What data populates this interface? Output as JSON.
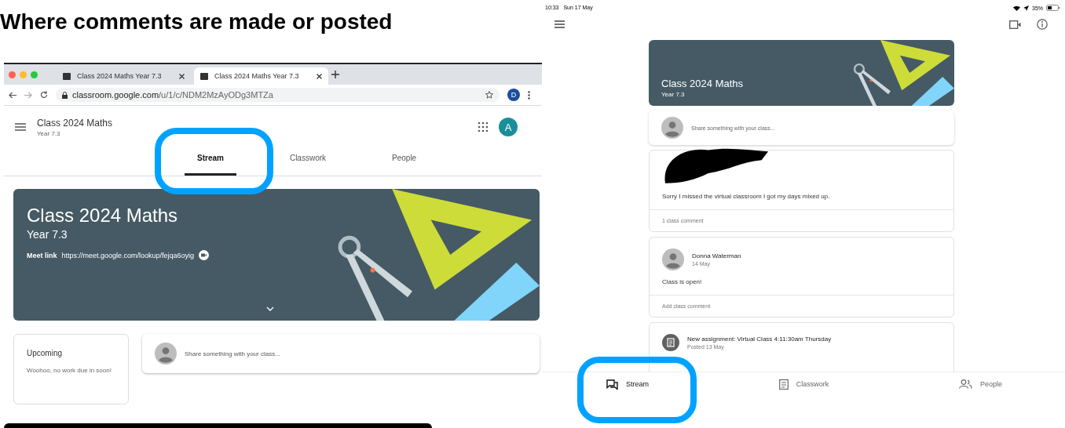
{
  "slide_title": "Where comments are made or posted",
  "browser": {
    "tabs": [
      {
        "label": "Class 2024 Maths Year 7.3",
        "selected": false
      },
      {
        "label": "Class 2024 Maths Year 7.3",
        "selected": true
      }
    ],
    "url_host": "classroom.google.com",
    "url_path": "/u/1/c/NDM2MzAyODg3MTZa",
    "profile_initial": "D"
  },
  "web_app": {
    "class_name": "Class 2024 Maths",
    "section": "Year 7.3",
    "account_initial": "A",
    "nav_tabs": [
      {
        "label": "Stream",
        "selected": true
      },
      {
        "label": "Classwork",
        "selected": false
      },
      {
        "label": "People",
        "selected": false
      }
    ],
    "banner": {
      "title": "Class 2024 Maths",
      "subtitle": "Year 7.3",
      "meet_label": "Meet link",
      "meet_url": "https://meet.google.com/lookup/fejqa6oyig"
    },
    "upcoming": {
      "title": "Upcoming",
      "text": "Woohoo, no work due in soon!"
    },
    "share_placeholder": "Share something with your class..."
  },
  "tablet": {
    "status_bar": {
      "time": "10:33",
      "date": "Sun 17 May",
      "battery": "35%"
    },
    "banner": {
      "title": "Class 2024 Maths",
      "subtitle": "Year 7.3"
    },
    "share_placeholder": "Share something with your class...",
    "posts": [
      {
        "kind": "redacted",
        "text": "Sorry I missed the virtual classroom I got my days mixed up.",
        "footer": "1 class comment"
      },
      {
        "kind": "announcement",
        "author": "Donna Waterman",
        "date": "14 May",
        "text": "Class is open!",
        "footer": "Add class comment"
      },
      {
        "kind": "assignment",
        "author": "New assignment: Virtual Class 4:11:30am Thursday",
        "date": "Posted 13 May"
      }
    ],
    "bottom_nav": [
      {
        "label": "Stream",
        "selected": true
      },
      {
        "label": "Classwork",
        "selected": false
      },
      {
        "label": "People",
        "selected": false
      }
    ]
  }
}
